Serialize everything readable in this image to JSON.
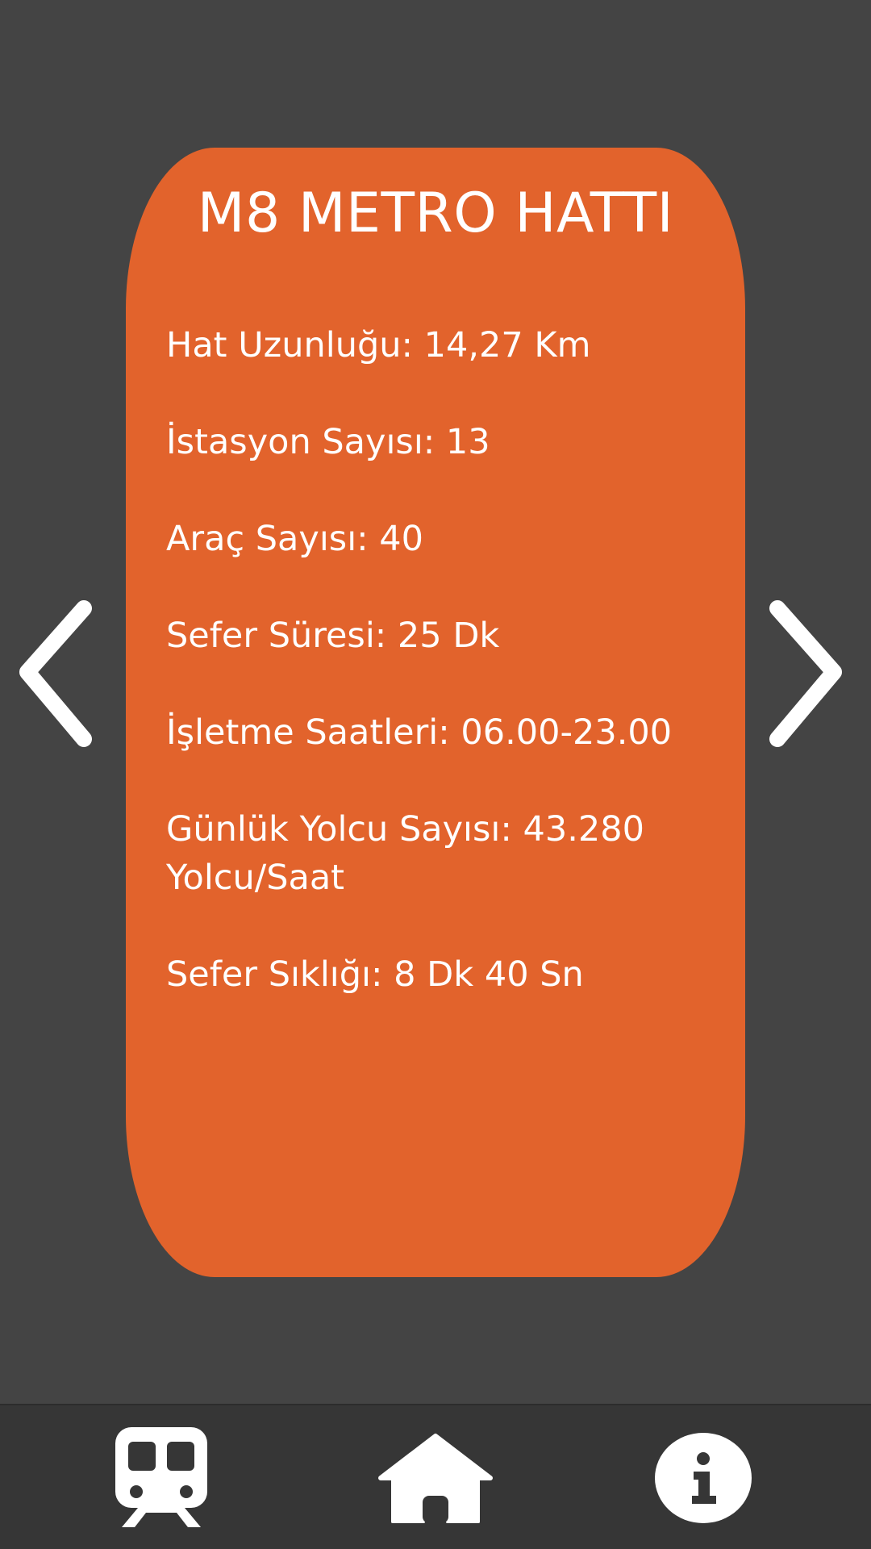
{
  "card": {
    "title": "M8 METRO HATTI",
    "items": [
      {
        "label": "Hat Uzunluğu: 14,27 Km"
      },
      {
        "label": "İstasyon Sayısı: 13"
      },
      {
        "label": "Araç Sayısı: 40"
      },
      {
        "label": "Sefer Süresi: 25 Dk"
      },
      {
        "label": "İşletme Saatleri: 06.00-23.00"
      },
      {
        "label": "Günlük Yolcu Sayısı: 43.280",
        "label2": "Yolcu/Saat"
      },
      {
        "label": "Sefer Sıklığı: 8 Dk 40 Sn"
      }
    ]
  },
  "colors": {
    "background": "#444444",
    "card": "#E2632C",
    "bottom_bar": "#363636",
    "text": "#FFFFFF"
  },
  "icons": {
    "prev": "chevron-left-icon",
    "next": "chevron-right-icon",
    "metro_tab": "train-icon",
    "home_tab": "home-icon",
    "info_tab": "info-icon"
  }
}
